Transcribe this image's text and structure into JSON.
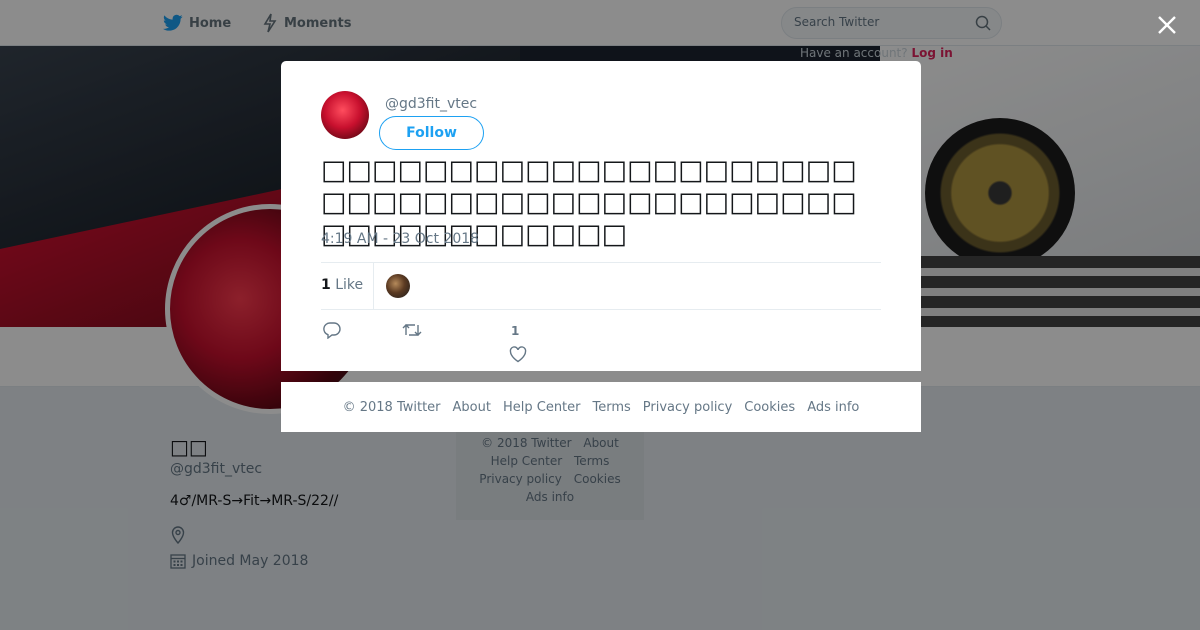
{
  "nav": {
    "home_label": "Home",
    "moments_label": "Moments",
    "search_placeholder": "Search Twitter"
  },
  "banner": {
    "login_text_prefix": "Have an account?",
    "login_link": "Log in"
  },
  "profile": {
    "name": "□□",
    "handle": "@gd3fit_vtec",
    "bio": "4♂/MR-S→Fit→MR-S/22//",
    "joined": "Joined May 2018"
  },
  "side_footer": {
    "links": [
      "© 2018 Twitter",
      "About",
      "Help Center",
      "Terms",
      "Privacy policy",
      "Cookies",
      "Ads info"
    ]
  },
  "tweet": {
    "handle": "@gd3fit_vtec",
    "follow_label": "Follow",
    "text": "□□□□□□□□□□□□□□□□□□□□□□□□□□□□□□□□□□□□□□□□□□□□□□□□□□□□□□",
    "timestamp": "4:19 AM - 23 Oct 2018",
    "like_count": "1",
    "like_label": "Like",
    "action_like_count": "1"
  },
  "modal_footer": {
    "copyright": "© 2018 Twitter",
    "about": "About",
    "help": "Help Center",
    "terms": "Terms",
    "privacy": "Privacy policy",
    "cookies": "Cookies",
    "ads": "Ads info"
  },
  "colors": {
    "accent": "#1da1f2",
    "text_secondary": "#657786",
    "background": "#e6ecf0"
  },
  "icons": [
    "twitter-bird-icon",
    "lightning-icon",
    "search-icon",
    "close-icon",
    "location-pin-icon",
    "calendar-icon",
    "reply-icon",
    "retweet-icon",
    "heart-icon"
  ]
}
